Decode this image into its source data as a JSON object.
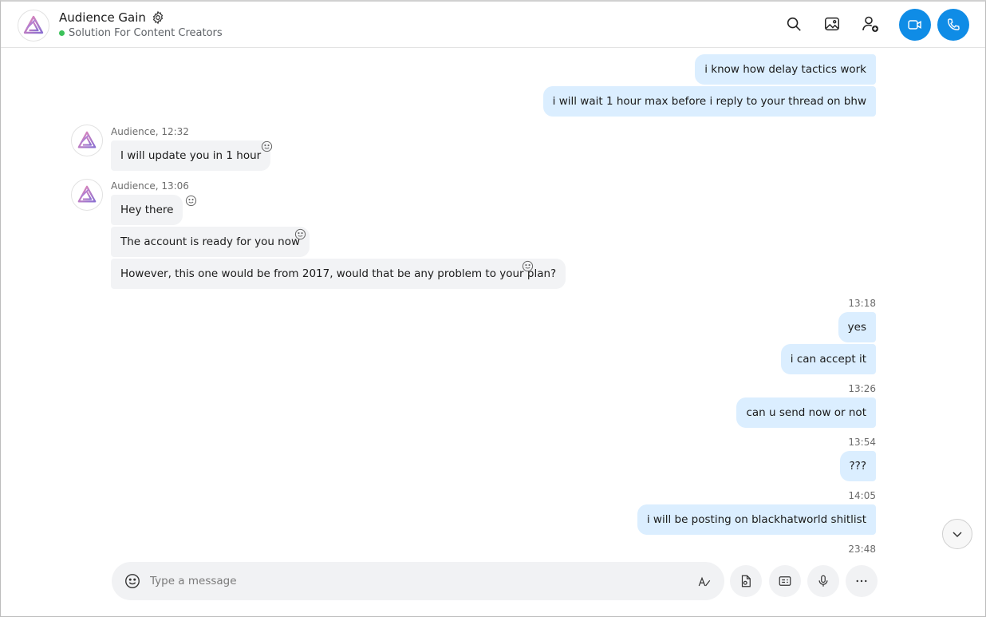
{
  "header": {
    "title": "Audience Gain",
    "subtitle": "Solution For Content Creators",
    "status_color": "#3cc25a"
  },
  "accent_color": "#0f8ce6",
  "messages": [
    {
      "dir": "out",
      "text": "i know how delay tactics work"
    },
    {
      "dir": "out",
      "text": "i will wait 1 hour max before i reply to your thread on bhw"
    },
    {
      "dir": "in",
      "sender": "Audience, 12:32",
      "text": "I will update you in 1 hour"
    },
    {
      "dir": "in",
      "sender": "Audience, 13:06",
      "text": "Hey there"
    },
    {
      "dir": "in",
      "text": "The account is ready for you now"
    },
    {
      "dir": "in",
      "text": "However, this one would be from 2017, would that be any problem to your plan?"
    },
    {
      "dir": "out",
      "time": "13:18",
      "text": "yes"
    },
    {
      "dir": "out",
      "text": "i can accept it"
    },
    {
      "dir": "out",
      "time": "13:26",
      "text": "can u send now or not"
    },
    {
      "dir": "out",
      "time": "13:54",
      "text": "???"
    },
    {
      "dir": "out",
      "time": "14:05",
      "text": "i will be posting on blackhatworld shitlist"
    },
    {
      "dir": "out",
      "time": "23:48"
    }
  ],
  "composer": {
    "placeholder": "Type a message"
  },
  "icons": {
    "header": [
      "search-icon",
      "gallery-icon",
      "add-person-icon",
      "video-call-icon",
      "audio-call-icon"
    ],
    "composer": [
      "emoji-icon",
      "format-icon",
      "file-icon",
      "contact-card-icon",
      "microphone-icon",
      "more-icon"
    ]
  }
}
